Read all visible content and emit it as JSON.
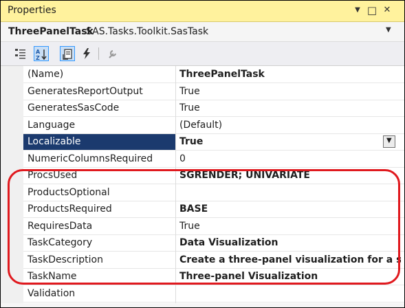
{
  "titlebar": {
    "title": "Properties",
    "buttons": [
      {
        "name": "dropdown-icon",
        "glyph": "▼"
      },
      {
        "name": "maximize-icon",
        "glyph": "□"
      },
      {
        "name": "close-icon",
        "glyph": "✕"
      }
    ]
  },
  "selector": {
    "object_name": "ThreePanelTask",
    "object_type": "SAS.Tasks.Toolkit.SasTask",
    "dropdown_glyph": "▼"
  },
  "toolbar": {
    "tools": [
      "categorized-icon",
      "alphabetical-icon",
      "property-pages-icon",
      "events-icon",
      "wrench-icon"
    ],
    "active": [
      "alphabetical-icon",
      "property-pages-icon"
    ]
  },
  "grid": {
    "rows": [
      {
        "name": "(Name)",
        "value": "ThreePanelTask",
        "bold": true
      },
      {
        "name": "GeneratesReportOutput",
        "value": "True",
        "bold": false
      },
      {
        "name": "GeneratesSasCode",
        "value": "True",
        "bold": false
      },
      {
        "name": "Language",
        "value": "(Default)",
        "bold": false
      },
      {
        "name": "Localizable",
        "value": "True",
        "bold": true,
        "selected": true
      },
      {
        "name": "NumericColumnsRequired",
        "value": "0",
        "bold": false
      },
      {
        "name": "ProcsUsed",
        "value": "SGRENDER; UNIVARIATE",
        "bold": true
      },
      {
        "name": "ProductsOptional",
        "value": "",
        "bold": false
      },
      {
        "name": "ProductsRequired",
        "value": "BASE",
        "bold": true
      },
      {
        "name": "RequiresData",
        "value": "True",
        "bold": false
      },
      {
        "name": "TaskCategory",
        "value": "Data Visualization",
        "bold": true
      },
      {
        "name": "TaskDescription",
        "value": "Create a three-panel visualization for a single",
        "bold": true
      },
      {
        "name": "TaskName",
        "value": "Three-panel Visualization",
        "bold": true
      },
      {
        "name": "Validation",
        "value": "",
        "bold": false
      }
    ]
  },
  "colors": {
    "titlebar_bg": "#fff29d",
    "selected_bg": "#1b3a6e",
    "highlight": "#e0191e"
  }
}
